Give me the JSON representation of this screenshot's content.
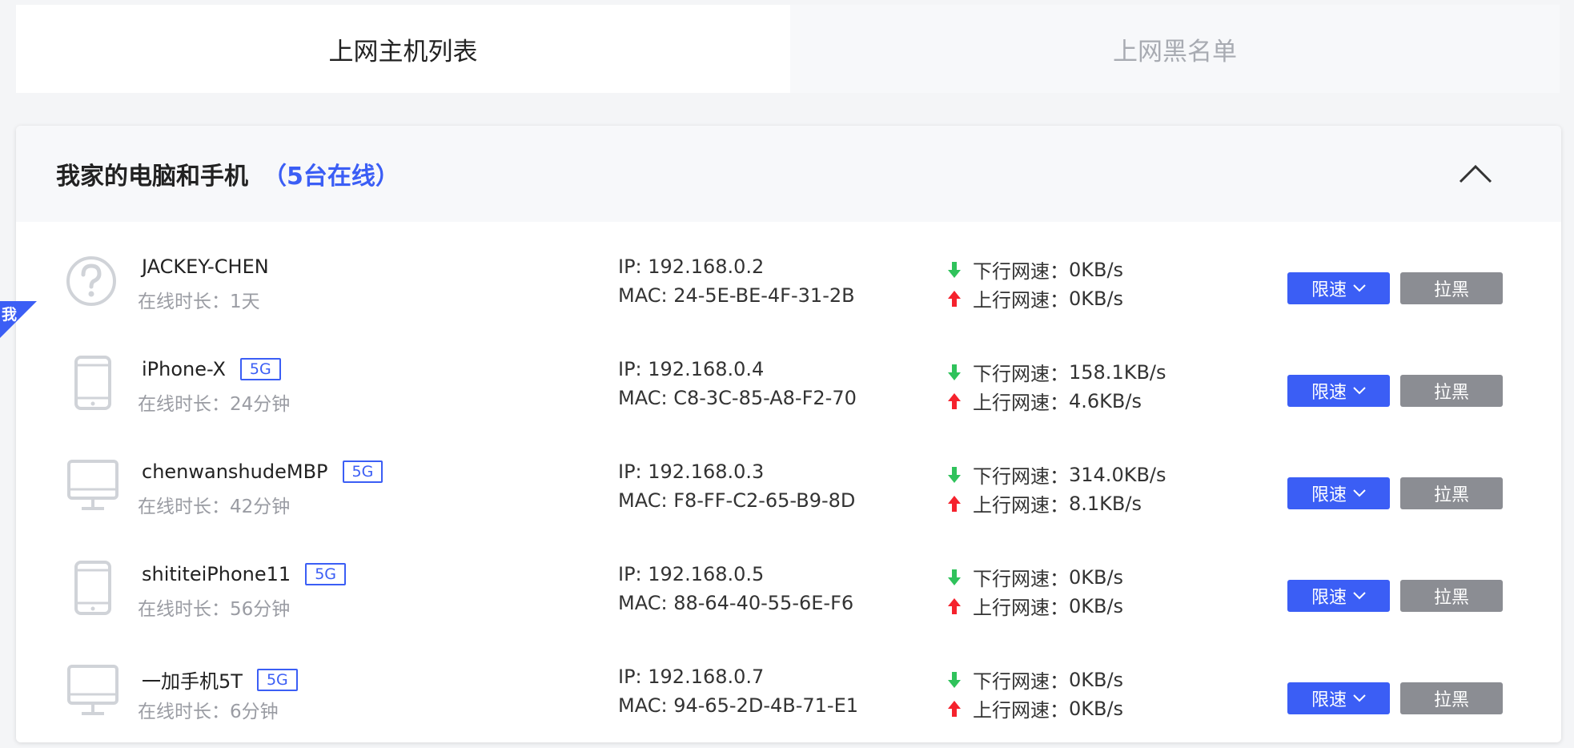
{
  "tabs": [
    {
      "label": "上网主机列表",
      "active": true
    },
    {
      "label": "上网黑名单",
      "active": false
    }
  ],
  "group": {
    "name": "我家的电脑和手机",
    "online": "（5台在线）"
  },
  "labels": {
    "ip_prefix": "IP: ",
    "mac_prefix": "MAC: ",
    "down": "下行网速：",
    "up": "上行网速：",
    "limit": "限速",
    "block": "拉黑",
    "me": "我"
  },
  "colors": {
    "accent": "#3b5ef5",
    "down_arrow": "#2fc25b",
    "up_arrow": "#f5222d",
    "block_button": "#8b8d93"
  },
  "devices": [
    {
      "name": "JACKEY-CHEN",
      "band": "",
      "icon": "unknown-device-icon",
      "time": "在线时长：1天",
      "ip": "192.168.0.2",
      "mac": "24-5E-BE-4F-31-2B",
      "down": "0KB/s",
      "up": "0KB/s"
    },
    {
      "name": "iPhone-X",
      "band": "5G",
      "icon": "phone-icon",
      "time": "在线时长：24分钟",
      "ip": "192.168.0.4",
      "mac": "C8-3C-85-A8-F2-70",
      "down": "158.1KB/s",
      "up": "4.6KB/s"
    },
    {
      "name": "chenwanshudeMBP",
      "band": "5G",
      "icon": "computer-icon",
      "time": "在线时长：42分钟",
      "ip": "192.168.0.3",
      "mac": "F8-FF-C2-65-B9-8D",
      "down": "314.0KB/s",
      "up": "8.1KB/s"
    },
    {
      "name": "shititeiPhone11",
      "band": "5G",
      "icon": "phone-icon",
      "time": "在线时长：56分钟",
      "ip": "192.168.0.5",
      "mac": "88-64-40-55-6E-F6",
      "down": "0KB/s",
      "up": "0KB/s"
    },
    {
      "name": "一加手机5T",
      "band": "5G",
      "icon": "computer-icon",
      "time": "在线时长：6分钟",
      "ip": "192.168.0.7",
      "mac": "94-65-2D-4B-71-E1",
      "down": "0KB/s",
      "up": "0KB/s"
    }
  ]
}
